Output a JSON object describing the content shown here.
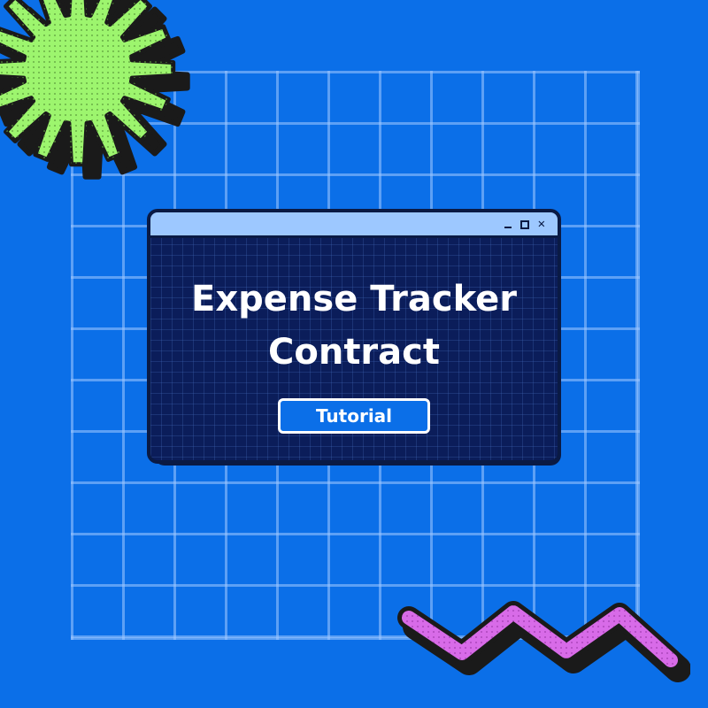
{
  "colors": {
    "background": "#0b6fe8",
    "window_body": "#0b1d5a",
    "titlebar": "#9dc8ff",
    "outline": "#0a1a44",
    "starburst": "#9df56e",
    "zigzag": "#d86be8",
    "text": "#ffffff"
  },
  "window": {
    "title_line_1": "Expense Tracker",
    "title_line_2": "Contract",
    "button_label": "Tutorial",
    "controls": [
      "minimize-icon",
      "maximize-icon",
      "close-icon"
    ]
  },
  "decorations": [
    "starburst-icon",
    "zigzag-icon",
    "grid-background"
  ]
}
